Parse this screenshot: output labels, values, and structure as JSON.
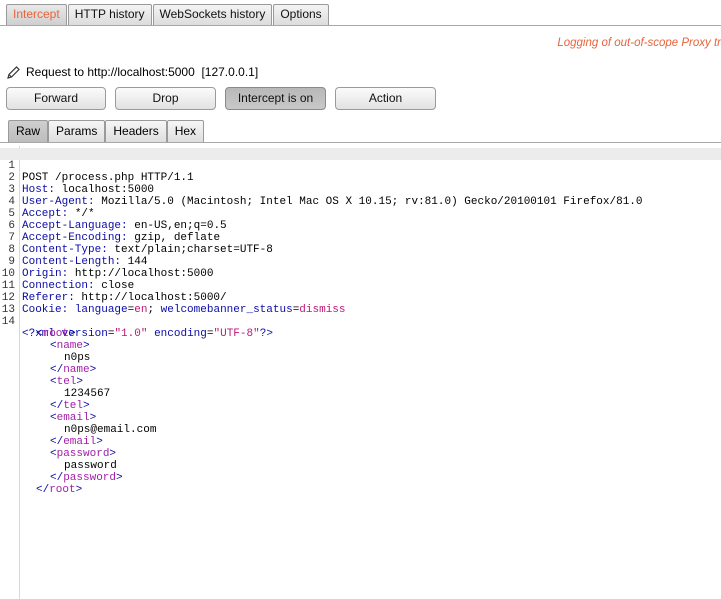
{
  "top_tabs": [
    "Intercept",
    "HTTP history",
    "WebSockets history",
    "Options"
  ],
  "log_message": "Logging of out-of-scope Proxy tr",
  "request_info": {
    "label": "Request to http://localhost:5000",
    "ip": "[127.0.0.1]"
  },
  "actions": {
    "forward": "Forward",
    "drop": "Drop",
    "intercept": "Intercept is on",
    "action": "Action"
  },
  "view_tabs": [
    "Raw",
    "Params",
    "Headers",
    "Hex"
  ],
  "request_line": "POST /process.php HTTP/1.1",
  "headers": [
    {
      "name": "Host:",
      "value": " localhost:5000"
    },
    {
      "name": "User-Agent:",
      "value": " Mozilla/5.0 (Macintosh; Intel Mac OS X 10.15; rv:81.0) Gecko/20100101 Firefox/81.0"
    },
    {
      "name": "Accept:",
      "value": " */*"
    },
    {
      "name": "Accept-Language:",
      "value": " en-US,en;q=0.5"
    },
    {
      "name": "Accept-Encoding:",
      "value": " gzip, deflate"
    },
    {
      "name": "Content-Type:",
      "value": " text/plain;charset=UTF-8"
    },
    {
      "name": "Content-Length:",
      "value": " 144"
    },
    {
      "name": "Origin:",
      "value": " http://localhost:5000"
    },
    {
      "name": "Connection:",
      "value": " close"
    },
    {
      "name": "Referer:",
      "value": " http://localhost:5000/"
    }
  ],
  "cookie": {
    "name": "Cookie:",
    "pairs": [
      {
        "key": "language",
        "value": "en"
      },
      {
        "key": "welcomebanner_status",
        "value": "dismiss"
      }
    ]
  },
  "line_numbers": [
    "1",
    "2",
    "3",
    "4",
    "5",
    "6",
    "7",
    "8",
    "9",
    "10",
    "11",
    "12",
    "13",
    "14"
  ],
  "xml": {
    "decl_open": "<?xml",
    "version_attr": "version",
    "version_val": "\"1.0\"",
    "encoding_attr": "encoding",
    "encoding_val": "\"UTF-8\"",
    "decl_close": "?>",
    "root": "root",
    "fields": [
      {
        "tag": "name",
        "value": "n0ps"
      },
      {
        "tag": "tel",
        "value": "1234567"
      },
      {
        "tag": "email",
        "value": "n0ps@email.com"
      },
      {
        "tag": "password",
        "value": "password"
      }
    ]
  },
  "colors": {
    "accent": "#e8633b",
    "header_blue": "#0b0ba8",
    "value_magenta": "#c0167a",
    "tag_purple": "#a21ea8"
  }
}
